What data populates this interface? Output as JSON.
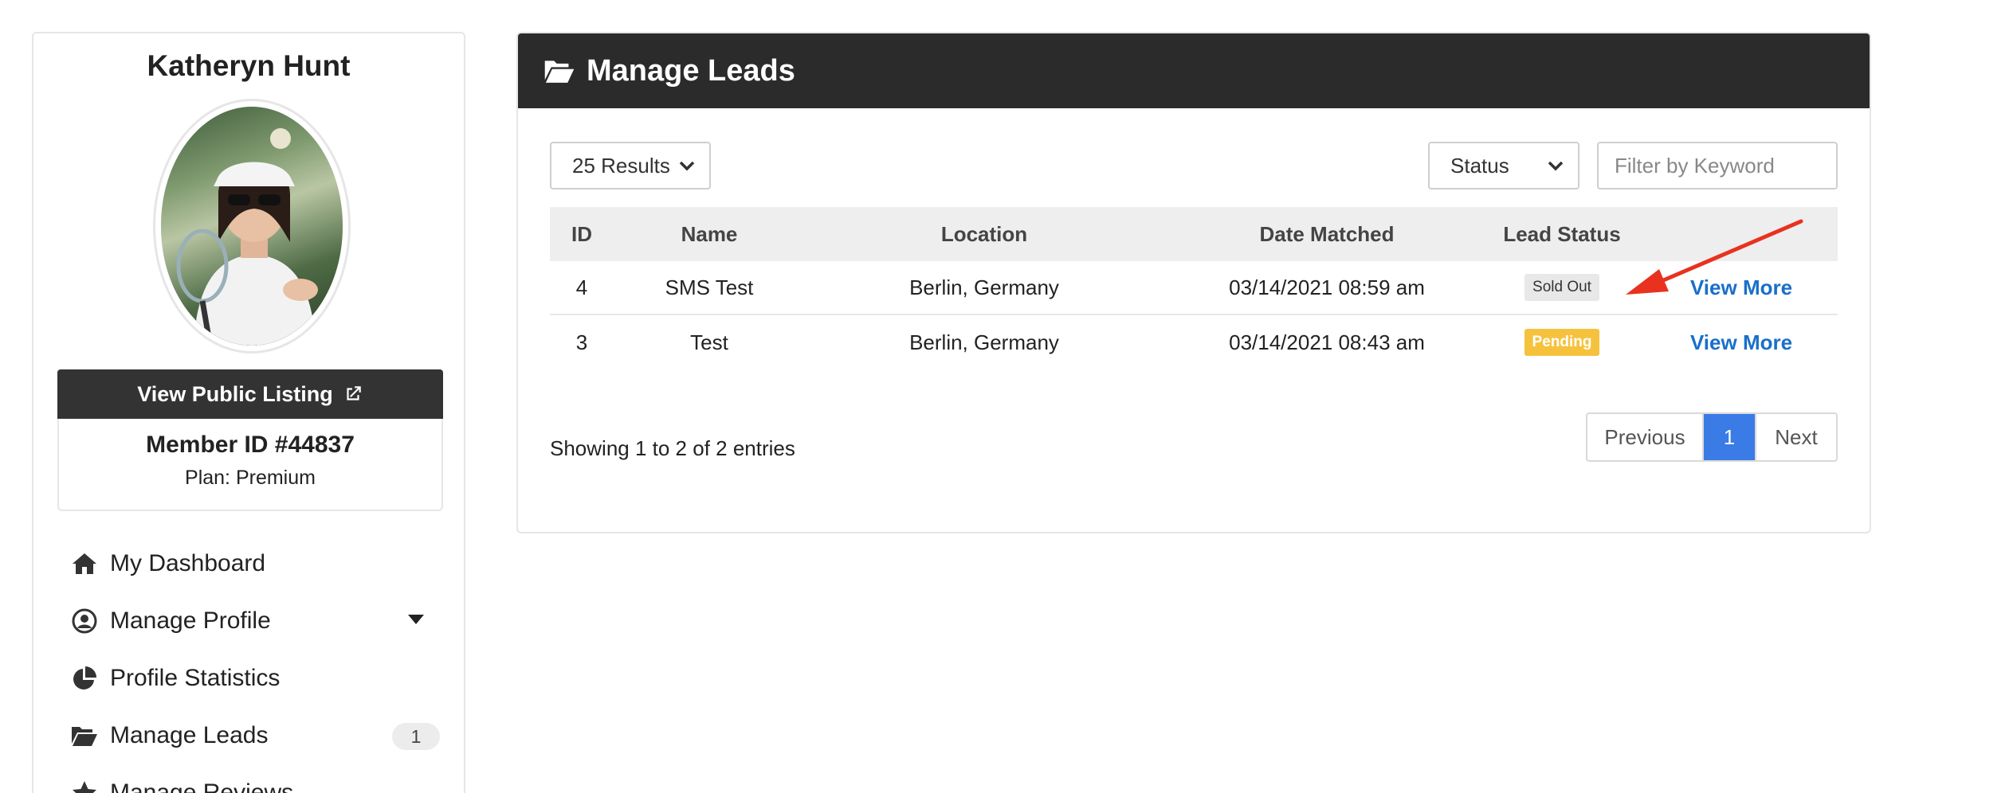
{
  "profile": {
    "name": "Katheryn Hunt",
    "public_listing_label": "View Public Listing",
    "member_id": "Member ID #44837",
    "plan": "Plan: Premium"
  },
  "nav": {
    "items": [
      {
        "label": "My Dashboard",
        "icon": "home-icon"
      },
      {
        "label": "Manage Profile",
        "icon": "user-circle-icon"
      },
      {
        "label": "Profile Statistics",
        "icon": "pie-chart-icon"
      },
      {
        "label": "Manage Leads",
        "icon": "folder-open-icon",
        "badge": "1"
      },
      {
        "label": "Manage Reviews",
        "icon": "star-icon"
      }
    ]
  },
  "panel": {
    "title": "Manage Leads",
    "results_select": "25 Results",
    "status_select": "Status",
    "filter_placeholder": "Filter by Keyword",
    "columns": [
      "ID",
      "Name",
      "Location",
      "Date Matched",
      "Lead Status"
    ],
    "rows": [
      {
        "id": "4",
        "name": "SMS Test",
        "location": "Berlin, Germany",
        "date": "03/14/2021 08:59 am",
        "status": "Sold Out",
        "action": "View More"
      },
      {
        "id": "3",
        "name": "Test",
        "location": "Berlin, Germany",
        "date": "03/14/2021 08:43 am",
        "status": "Pending",
        "action": "View More"
      }
    ],
    "showing": "Showing 1 to 2 of 2 entries",
    "pager": {
      "previous": "Previous",
      "current": "1",
      "next": "Next"
    }
  },
  "colors": {
    "header_bg": "#2b2b2b",
    "link": "#1a6fc9",
    "pending": "#f6c23e",
    "page_active": "#3a7be6",
    "annotation_arrow": "#e8321f"
  }
}
